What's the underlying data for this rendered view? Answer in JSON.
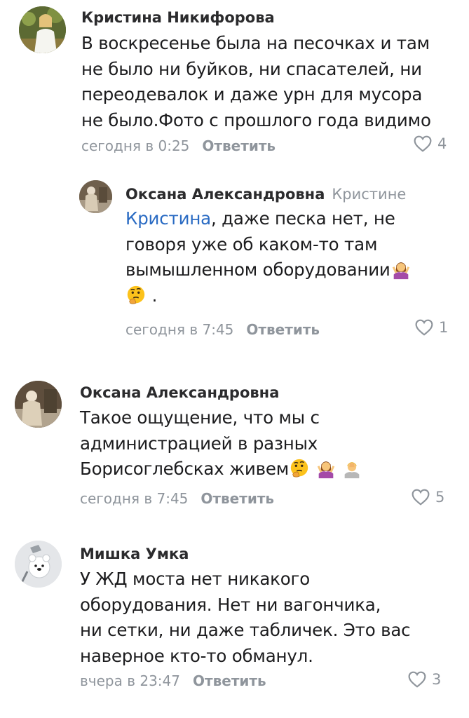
{
  "comments": [
    {
      "author": "Кристина Никифорова",
      "lines": [
        "В воскресенье была на песочках и там",
        "не было ни буйков, ни спасателей, ни",
        "переодевалок и даже урн для мусора",
        "не было.Фото с прошлого года видимо"
      ],
      "time": "сегодня в 0:25",
      "reply_label": "Ответить",
      "likes": "4"
    },
    {
      "author": "Оксана Александровна",
      "reply_to": "Кристине",
      "mention": "Кристина",
      "line1_rest": ", даже песка нет, не",
      "line2": "говоря уже об каком-то там",
      "line3": "вымышленном оборудовании",
      "line4_suffix": ".",
      "emojis": [
        "person-shrugging-emoji",
        "thinking-face-emoji"
      ],
      "time": "сегодня в 7:45",
      "reply_label": "Ответить",
      "likes": "1"
    },
    {
      "author": "Оксана Александровна",
      "lines": [
        "Такое ощущение, что мы с",
        "администрацией в разных",
        "Борисоглебсках живем"
      ],
      "emojis": [
        "thinking-face-emoji",
        "person-shrugging-emoji",
        "person-facepalming-emoji"
      ],
      "time": "сегодня в 7:45",
      "reply_label": "Ответить",
      "likes": "5"
    },
    {
      "author": "Мишка Умка",
      "lines": [
        "У ЖД моста нет никакого",
        "оборудования. Нет ни вагончика,",
        "ни сетки, ни даже табличек. Это вас",
        "наверное кто-то обманул."
      ],
      "time": "вчера в 23:47",
      "reply_label": "Ответить",
      "likes": "3"
    }
  ],
  "colors": {
    "text": "#1c1c1e",
    "secondary": "#8f959c",
    "link": "#2a6bc3"
  }
}
